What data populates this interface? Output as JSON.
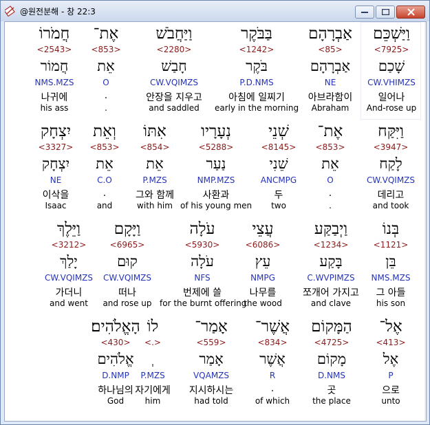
{
  "window": {
    "title": "@원전분해 - 창 22:3",
    "icon": "bible-app-icon",
    "buttons": [
      "minimize",
      "maximize",
      "close"
    ]
  },
  "rows": [
    {
      "words": [
        {
          "heb": "וַיַּשְׁכֵּם",
          "num": "<7925>",
          "lemma": "שָׁכַם",
          "pars": "CW.VHIMZS",
          "kor": "일어나",
          "eng": "And-rose up"
        },
        {
          "heb": "אַבְרָהָם",
          "num": "<85>",
          "lemma": "אַבְרָהָם",
          "pars": "NE",
          "kor": "아브라함이",
          "eng": "Abraham"
        },
        {
          "heb": "בַּבֹּקֶר",
          "num": "<1242>",
          "lemma": "בֹּקֶר",
          "pars": "P.D.NMS",
          "kor": "아침에 일찌기",
          "eng": "early in the morning"
        },
        {
          "heb": "וַיַּחֲבֹשׁ",
          "num": "<2280>",
          "lemma": "חָבַשׁ",
          "pars": "CW.VQIMZS",
          "kor": "안장을 지우고",
          "eng": "and saddled"
        },
        {
          "heb": "אֶת־",
          "num": "<853>",
          "lemma": "אֵת",
          "pars": "O",
          "kor": ".",
          "eng": "."
        },
        {
          "heb": "חֲמֹרוֹ",
          "num": "<2543>",
          "lemma": "חֲמוֹר",
          "pars": "NMS.MZS",
          "kor": "나귀에",
          "eng": "his ass"
        }
      ]
    },
    {
      "words": [
        {
          "heb": "וַיִּקַּח",
          "num": "<3947>",
          "lemma": "לָקַח",
          "pars": "CW.VQIMZS",
          "kor": "데리고",
          "eng": "and took"
        },
        {
          "heb": "אֶת־",
          "num": "<853>",
          "lemma": "אֵת",
          "pars": "O",
          "kor": ".",
          "eng": "."
        },
        {
          "heb": "שְׁנֵי",
          "num": "<8145>",
          "lemma": "שֵׁנִי",
          "pars": "ANCMPG",
          "kor": "두",
          "eng": "two"
        },
        {
          "heb": "נְעָרָיו",
          "num": "<5288>",
          "lemma": "נַעַר",
          "pars": "NMP.MZS",
          "kor": "사환과",
          "eng": "of his young men"
        },
        {
          "heb": "אִתּוֹ",
          "num": "<854>",
          "lemma": "אֵת",
          "pars": "P.MZS",
          "kor": "그와 함께",
          "eng": "with him"
        },
        {
          "heb": "וְאֵת",
          "num": "<853>",
          "lemma": "אֵת",
          "pars": "C.O",
          "kor": ".",
          "eng": "and"
        },
        {
          "heb": "יִצְחָק",
          "num": "<3327>",
          "lemma": "יִצְחָק",
          "pars": "NE",
          "kor": "이삭을",
          "eng": "Isaac"
        }
      ]
    },
    {
      "words": [
        {
          "heb": "בְּנוֹ",
          "num": "<1121>",
          "lemma": "בֵּן",
          "pars": "NMS.MZS",
          "kor": "그 아들",
          "eng": "his son"
        },
        {
          "heb": "וַיְבַקַּע",
          "num": "<1234>",
          "lemma": "בָּקַע",
          "pars": "C.WVPIMZS",
          "kor": "쪼개어 가지고",
          "eng": "and clave"
        },
        {
          "heb": "עֲצֵי",
          "num": "<6086>",
          "lemma": "עֵץ",
          "pars": "NMPG",
          "kor": "나무를",
          "eng": "the wood"
        },
        {
          "heb": "עֹלָה",
          "num": "<5930>",
          "lemma": "עֹלָה",
          "pars": "NFS",
          "kor": "번제에 쓸",
          "eng": "for the burnt offering"
        },
        {
          "heb": "וַיָּקָם",
          "num": "<6965>",
          "lemma": "קוּם",
          "pars": "CW.VQIMZS",
          "kor": "떠나",
          "eng": "and rose up"
        },
        {
          "heb": "וַיֵּלֶךְ",
          "num": "<3212>",
          "lemma": "יָלַךְ",
          "pars": "CW.VQIMZS",
          "kor": "가더니",
          "eng": "and went"
        }
      ]
    },
    {
      "words": [
        {
          "heb": "אֶל־",
          "num": "<413>",
          "lemma": "אֶל",
          "pars": "P",
          "kor": "으로",
          "eng": "unto"
        },
        {
          "heb": "הַמָּקוֹם",
          "num": "<4725>",
          "lemma": "מָקוֹם",
          "pars": "D.NMS",
          "kor": "곳",
          "eng": "the place"
        },
        {
          "heb": "אֲשֶׁר־",
          "num": "<834>",
          "lemma": "אֲשֶׁר",
          "pars": "R",
          "kor": ".",
          "eng": "of which"
        },
        {
          "heb": "אָמַר־",
          "num": "<559>",
          "lemma": "אָמַר",
          "pars": "VQAMZS",
          "kor": "지시하시는",
          "eng": "had told"
        },
        {
          "heb": "לוֹ",
          "num": "<.>",
          "lemma": "ְ",
          "pars": "P.MZS",
          "kor": "자기에게",
          "eng": "him"
        },
        {
          "heb": "הָאֱלֹהִים׃",
          "num": "<430>",
          "lemma": "אֱלֹהִים",
          "pars": "D.NMP",
          "kor": "하나님의",
          "eng": "God"
        }
      ]
    }
  ]
}
